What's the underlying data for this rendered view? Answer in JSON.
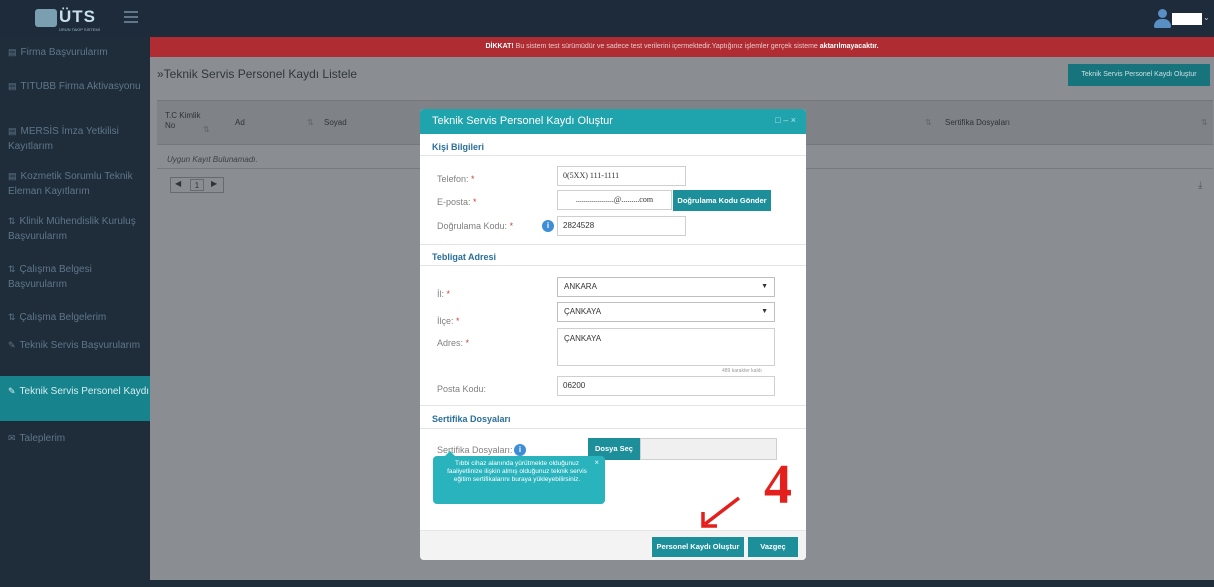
{
  "app": {
    "logo_text": "ÜTS",
    "logo_subtext": "ÜRÜN TAKİP SİSTEMİ"
  },
  "warning": {
    "prefix": "DİKKAT!",
    "message": "Bu sistem test sürümüdür ve sadece test verilerini içermektedir.Yaptığınız işlemler gerçek sisteme",
    "emphasis": "aktarılmayacaktır."
  },
  "sidebar": {
    "items": [
      {
        "icon": "file-icon",
        "label": "Firma Başvurularım"
      },
      {
        "icon": "file-icon",
        "label": "TITUBB Firma Aktivasyonu"
      },
      {
        "icon": "file-icon",
        "label": "MERSİS İmza Yetkilisi Kayıtlarım"
      },
      {
        "icon": "file-icon",
        "label": "Kozmetik Sorumlu Teknik Eleman Kayıtlarım"
      },
      {
        "icon": "sort-icon",
        "label": "Klinik Mühendislik Kuruluş Başvurularım"
      },
      {
        "icon": "sort-icon",
        "label": "Çalışma Belgesi Başvurularım"
      },
      {
        "icon": "sort-icon",
        "label": "Çalışma Belgelerim"
      },
      {
        "icon": "pencil-icon",
        "label": "Teknik Servis Başvurularım"
      },
      {
        "icon": "pencil-icon",
        "label": "Teknik Servis Personel Kaydı"
      },
      {
        "icon": "chat-icon",
        "label": "Taleplerim"
      }
    ]
  },
  "page": {
    "title": "»Teknik Servis Personel Kaydı Listele",
    "create_button": "Teknik Servis Personel Kaydı Oluştur"
  },
  "table": {
    "headers": [
      "T.C Kimlik No",
      "Ad",
      "Soyad",
      "Sertifika Dosyaları"
    ],
    "empty_text": "Uygun Kayıt Bulunamadı.",
    "pager": {
      "prev": "◀",
      "page": "1",
      "next": "▶"
    }
  },
  "modal": {
    "title": "Teknik Servis Personel Kaydı Oluştur",
    "controls": "□ – ×",
    "section_personal": "Kişi Bilgileri",
    "phone_label": "Telefon:",
    "phone_value": "0(5XX) 111-1111",
    "email_label": "E-posta:",
    "email_value": "...................@.........com",
    "send_code_button": "Doğrulama Kodu Gönder",
    "code_label": "Doğrulama Kodu:",
    "code_value": "2824528",
    "section_address": "Tebligat Adresi",
    "city_label": "İl:",
    "city_value": "ANKARA",
    "district_label": "İlçe:",
    "district_value": "ÇANKAYA",
    "address_label": "Adres:",
    "address_value": "ÇANKAYA",
    "chars_left": "489 karakter kaldı",
    "postal_label": "Posta Kodu:",
    "postal_value": "06200",
    "section_certificates": "Sertifika Dosyaları",
    "certificates_label": "Sertifika Dosyaları:",
    "choose_file_button": "Dosya Seç",
    "tooltip_text": "Tıbbi cihaz alanında yürütmekte olduğunuz faaliyetlinize ilişkin almış olduğunuz teknik servis eğitim sertifikalarını buraya yükleyebilirsiniz.",
    "submit_button": "Personel Kaydı Oluştur",
    "cancel_button": "Vazgeç"
  },
  "annotation": {
    "step_number": "4",
    "arrow_color": "#e3201b"
  },
  "colors": {
    "accent": "#1d8f9b",
    "warning": "#b02c33",
    "sidebar_bg": "#1f2d3b"
  }
}
